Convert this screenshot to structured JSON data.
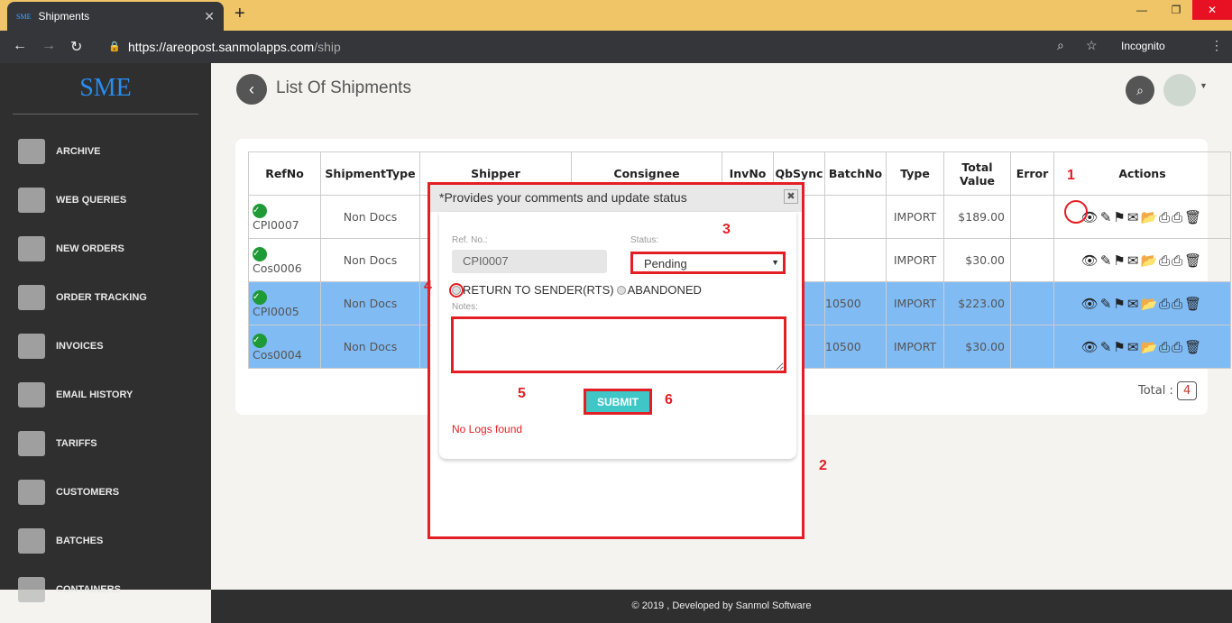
{
  "browser": {
    "tab_title": "Shipments",
    "favicon": "SME",
    "url_host": "https://areopost.sanmolapps.com",
    "url_path": "/ship",
    "mode": "Incognito"
  },
  "sidebar": {
    "logo": "SME",
    "items": [
      {
        "label": "ARCHIVE",
        "icon": "archive-icon"
      },
      {
        "label": "WEB QUERIES",
        "icon": "globe-icon"
      },
      {
        "label": "NEW ORDERS",
        "icon": "cart-icon"
      },
      {
        "label": "ORDER TRACKING",
        "icon": "truck-icon"
      },
      {
        "label": "INVOICES",
        "icon": "invoice-icon"
      },
      {
        "label": "EMAIL HISTORY",
        "icon": "email-clock-icon"
      },
      {
        "label": "TARIFFS",
        "icon": "tariff-icon"
      },
      {
        "label": "CUSTOMERS",
        "icon": "users-icon"
      },
      {
        "label": "BATCHES",
        "icon": "blocks-icon"
      },
      {
        "label": "CONTAINERS",
        "icon": "container-icon"
      }
    ]
  },
  "header": {
    "title": "List Of Shipments"
  },
  "table": {
    "columns": [
      "RefNo",
      "ShipmentType",
      "Shipper",
      "Consignee",
      "InvNo",
      "QbSync",
      "BatchNo",
      "Type",
      "Total Value",
      "Error",
      "Actions"
    ],
    "rows": [
      {
        "ref": "CPI0007",
        "shipment_type": "Non Docs",
        "batch": "",
        "type": "IMPORT",
        "total": "$189.00",
        "selected": false
      },
      {
        "ref": "Cos0006",
        "shipment_type": "Non Docs",
        "batch": "",
        "type": "IMPORT",
        "total": "$30.00",
        "selected": false
      },
      {
        "ref": "CPI0005",
        "shipment_type": "Non Docs",
        "batch": "10500",
        "type": "IMPORT",
        "total": "$223.00",
        "selected": true
      },
      {
        "ref": "Cos0004",
        "shipment_type": "Non Docs",
        "batch": "10500",
        "type": "IMPORT",
        "total": "$30.00",
        "selected": true
      }
    ],
    "actions": [
      "eye-icon",
      "edit-icon",
      "flag-icon",
      "envelope-icon",
      "folder-open-icon",
      "print-icon",
      "print-icon",
      "trash-icon"
    ],
    "total_label": "Total :",
    "total_count": "4"
  },
  "modal": {
    "title": "*Provides your comments and update status",
    "ref_label": "Ref. No.:",
    "ref_value": "CPI0007",
    "status_label": "Status:",
    "status_value": "Pending",
    "radio1": "RETURN TO SENDER(RTS)",
    "radio2": "ABANDONED",
    "notes_label": "Notes:",
    "submit": "SUBMIT",
    "no_logs": "No Logs found"
  },
  "annotations": [
    "1",
    "2",
    "3",
    "4",
    "5",
    "6"
  ],
  "footer": "© 2019 , Developed by Sanmol Software",
  "colors": {
    "annotation": "#e31e24",
    "selected_row": "#80bbf4",
    "submit": "#3fc7c7",
    "logo": "#2a8cf0"
  }
}
